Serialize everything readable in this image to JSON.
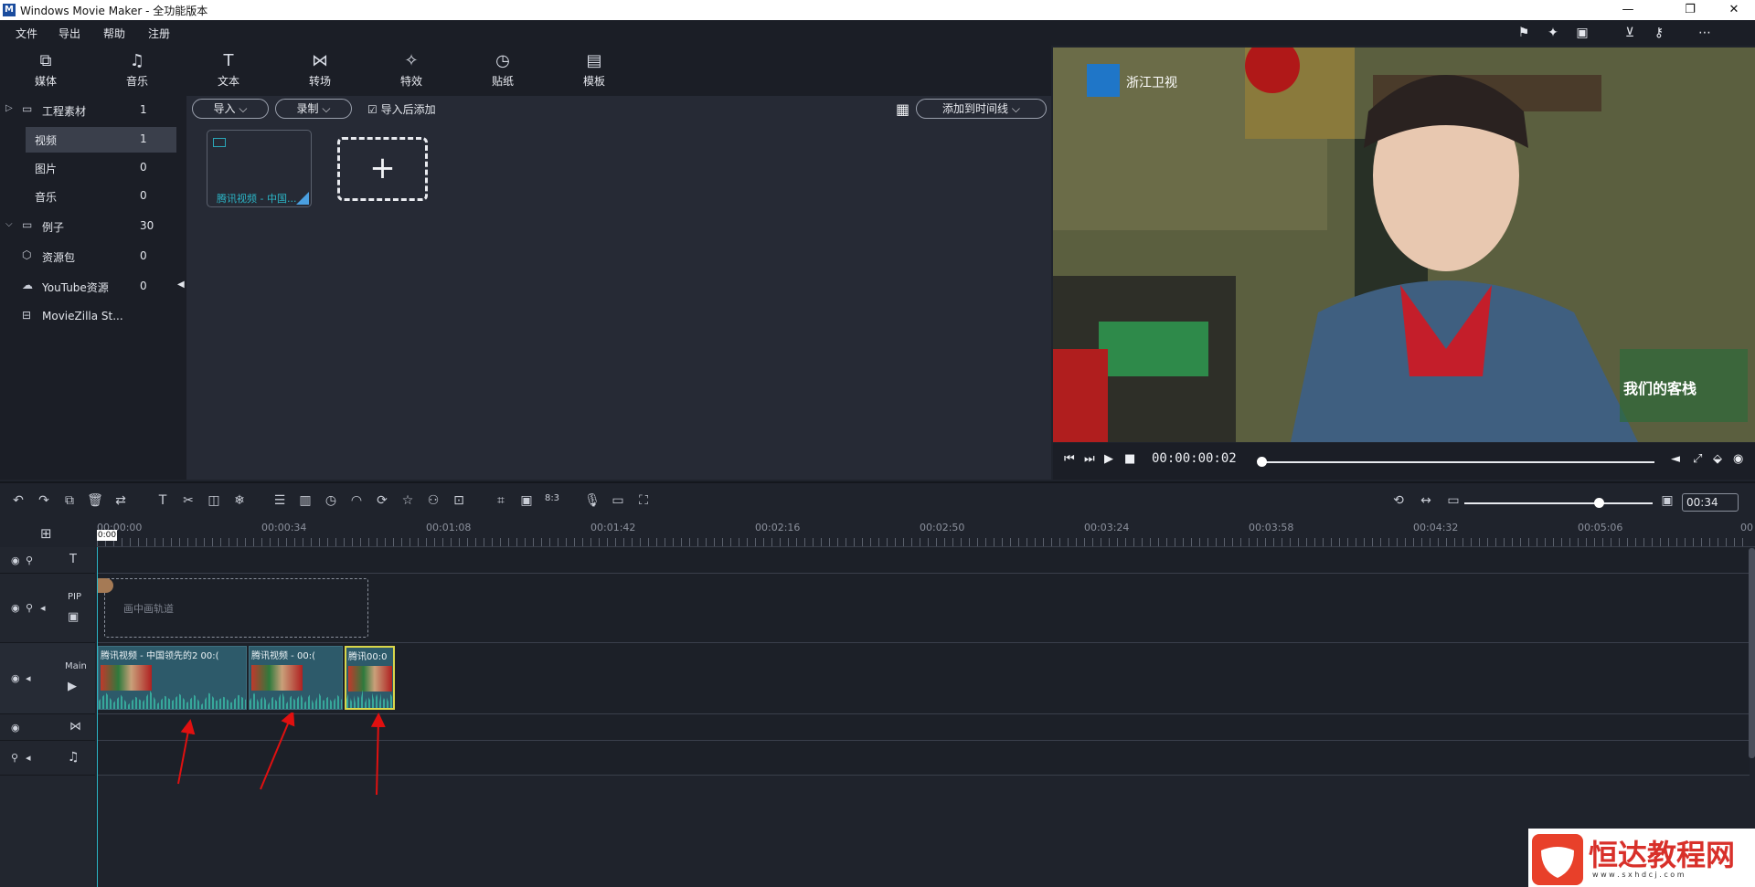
{
  "window": {
    "title": "Windows Movie Maker  - 全功能版本",
    "app_icon": "movie-maker-icon",
    "controls": [
      "minimize",
      "restore",
      "close"
    ]
  },
  "menu": [
    "文件",
    "导出",
    "帮助",
    "注册"
  ],
  "toolbar": {
    "tabs": [
      {
        "label": "媒体",
        "icon": "media-icon"
      },
      {
        "label": "音乐",
        "icon": "music-icon"
      },
      {
        "label": "文本",
        "icon": "text-icon"
      },
      {
        "label": "转场",
        "icon": "transition-icon"
      },
      {
        "label": "特效",
        "icon": "effects-icon"
      },
      {
        "label": "贴纸",
        "icon": "sticker-icon"
      },
      {
        "label": "模板",
        "icon": "template-icon"
      }
    ]
  },
  "sidebar": {
    "items": [
      {
        "label": "工程素材",
        "count": "1",
        "icon": "folder-icon"
      },
      {
        "label": "视频",
        "count": "1"
      },
      {
        "label": "图片",
        "count": "0"
      },
      {
        "label": "音乐",
        "count": "0"
      },
      {
        "label": "例子",
        "count": "30",
        "icon": "folder-icon"
      },
      {
        "label": "资源包",
        "count": "0",
        "icon": "package-icon"
      },
      {
        "label": "YouTube资源",
        "count": "0",
        "icon": "cloud-icon"
      },
      {
        "label": "MovieZilla St...",
        "count": "",
        "icon": "store-icon"
      }
    ]
  },
  "media_bar": {
    "import": "导入",
    "record": "录制",
    "add_after_import": "导入后添加",
    "add_to_timeline": "添加到时间线"
  },
  "media_items": [
    {
      "caption": "腾讯视频 - 中国..."
    }
  ],
  "preview": {
    "channel_logo": "浙江卫视",
    "show_logo": "我们的客栈"
  },
  "playback": {
    "timecode": "00:00:00:02"
  },
  "timeline": {
    "zoom_time": "00:34",
    "ruler_labels": [
      "00:00:00",
      "00:00:34",
      "00:01:08",
      "00:01:42",
      "00:02:16",
      "00:02:50",
      "00:03:24",
      "00:03:58",
      "00:04:32",
      "00:05:06",
      "00"
    ],
    "playhead_label": "0:00",
    "tracks": {
      "pip_label": "PIP",
      "pip_placeholder": "画中画轨道",
      "main_label": "Main"
    },
    "clips": [
      {
        "title": "腾讯视频 - 中国领先的2",
        "duration": "00:("
      },
      {
        "title": "腾讯视频 - ",
        "duration": "00:("
      },
      {
        "title": "腾讯00:0",
        "duration": ""
      }
    ]
  },
  "watermark": {
    "text": "恒达教程网",
    "url": "w w w . s x h d c j . c o m"
  }
}
